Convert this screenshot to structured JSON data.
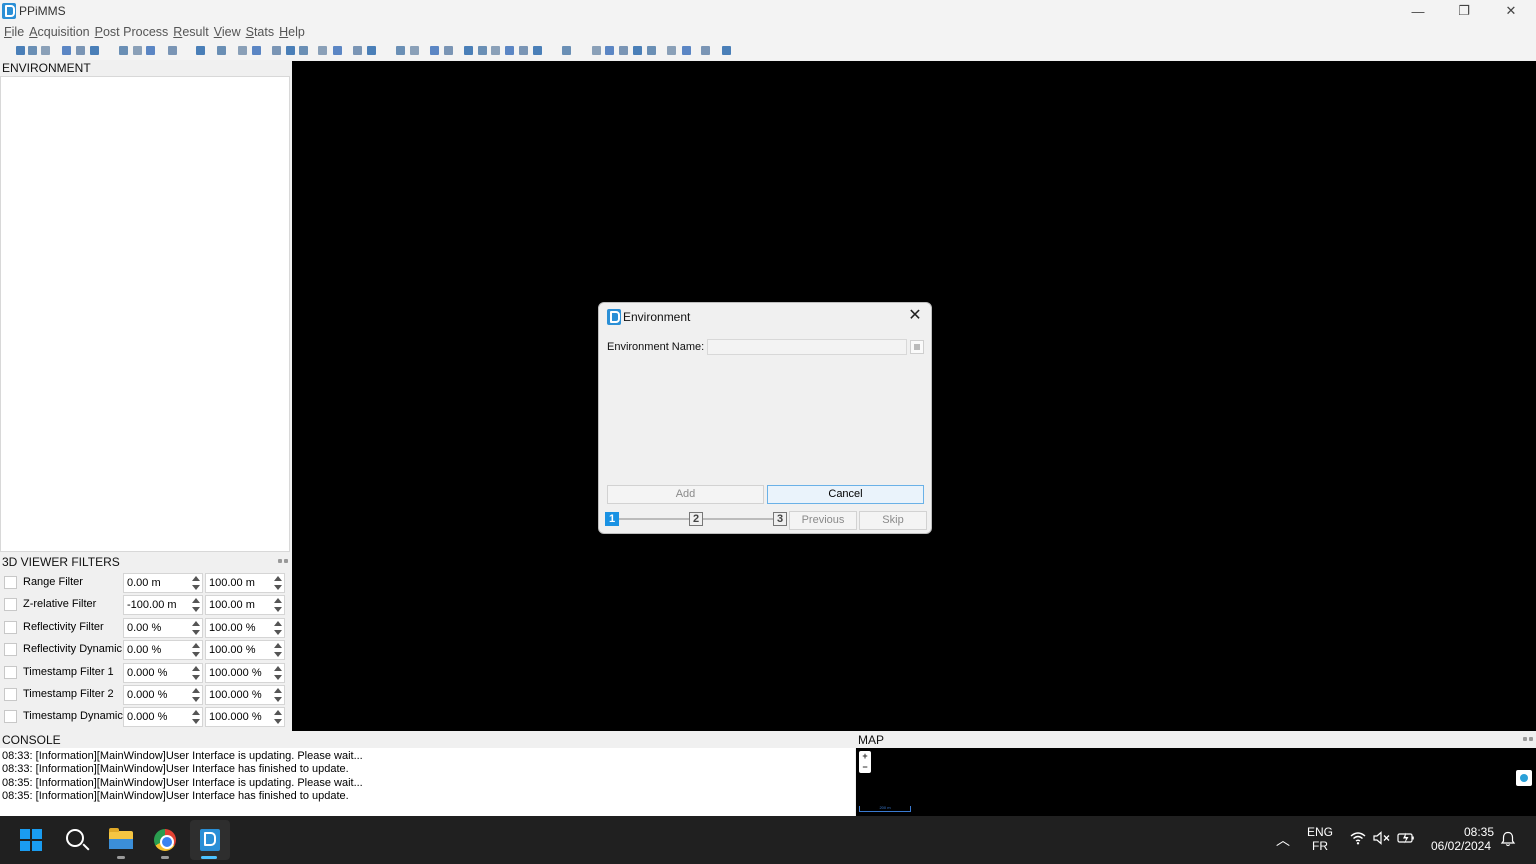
{
  "window": {
    "title": "PPiMMS",
    "controls": {
      "minimize": "—",
      "maximize": "❐",
      "close": "✕"
    }
  },
  "menu": [
    {
      "label": "File",
      "underline": "F",
      "rest": "ile"
    },
    {
      "label": "Acquisition",
      "underline": "A",
      "rest": "cquisition"
    },
    {
      "label": "Post Process",
      "underline": "P",
      "rest": "ost Process"
    },
    {
      "label": "Result",
      "underline": "R",
      "rest": "esult"
    },
    {
      "label": "View",
      "underline": "V",
      "rest": "iew"
    },
    {
      "label": "Stats",
      "underline": "S",
      "rest": "tats"
    },
    {
      "label": "Help",
      "underline": "H",
      "rest": "elp"
    }
  ],
  "environment_panel": {
    "title": "ENVIRONMENT"
  },
  "filters": {
    "title": "3D VIEWER FILTERS",
    "rows": [
      {
        "label": "Range Filter",
        "min": "0.00 m",
        "max": "100.00 m"
      },
      {
        "label": "Z-relative Filter",
        "min": "-100.00 m",
        "max": "100.00 m"
      },
      {
        "label": "Reflectivity Filter",
        "min": "0.00 %",
        "max": "100.00 %"
      },
      {
        "label": "Reflectivity Dynamic",
        "min": "0.00 %",
        "max": "100.00 %"
      },
      {
        "label": "Timestamp Filter 1",
        "min": "0.000 %",
        "max": "100.000 %"
      },
      {
        "label": "Timestamp Filter 2",
        "min": "0.000 %",
        "max": "100.000 %"
      },
      {
        "label": "Timestamp Dynamic",
        "min": "0.000 %",
        "max": "100.000 %"
      }
    ]
  },
  "dialog": {
    "title": "Environment",
    "close": "✕",
    "field_label": "Environment Name:",
    "field_value": "",
    "add_label": "Add",
    "cancel_label": "Cancel",
    "steps": [
      "1",
      "2",
      "3"
    ],
    "active_step": "1",
    "previous_label": "Previous",
    "skip_label": "Skip"
  },
  "console": {
    "title": "CONSOLE",
    "lines": [
      "08:33: [Information][MainWindow]User Interface is updating. Please wait...",
      "08:33: [Information][MainWindow]User Interface has finished to update.",
      "08:35: [Information][MainWindow]User Interface is updating. Please wait...",
      "08:35: [Information][MainWindow]User Interface has finished to update."
    ]
  },
  "map": {
    "title": "MAP",
    "zoom_in": "+",
    "zoom_out": "−",
    "scale": "200 m"
  },
  "taskbar": {
    "lang_top": "ENG",
    "lang_bottom": "FR",
    "time": "08:35",
    "date": "06/02/2024"
  },
  "colors": {
    "accent": "#1a92e3",
    "viewer_bg": "#000000",
    "taskbar_bg": "#202020"
  }
}
